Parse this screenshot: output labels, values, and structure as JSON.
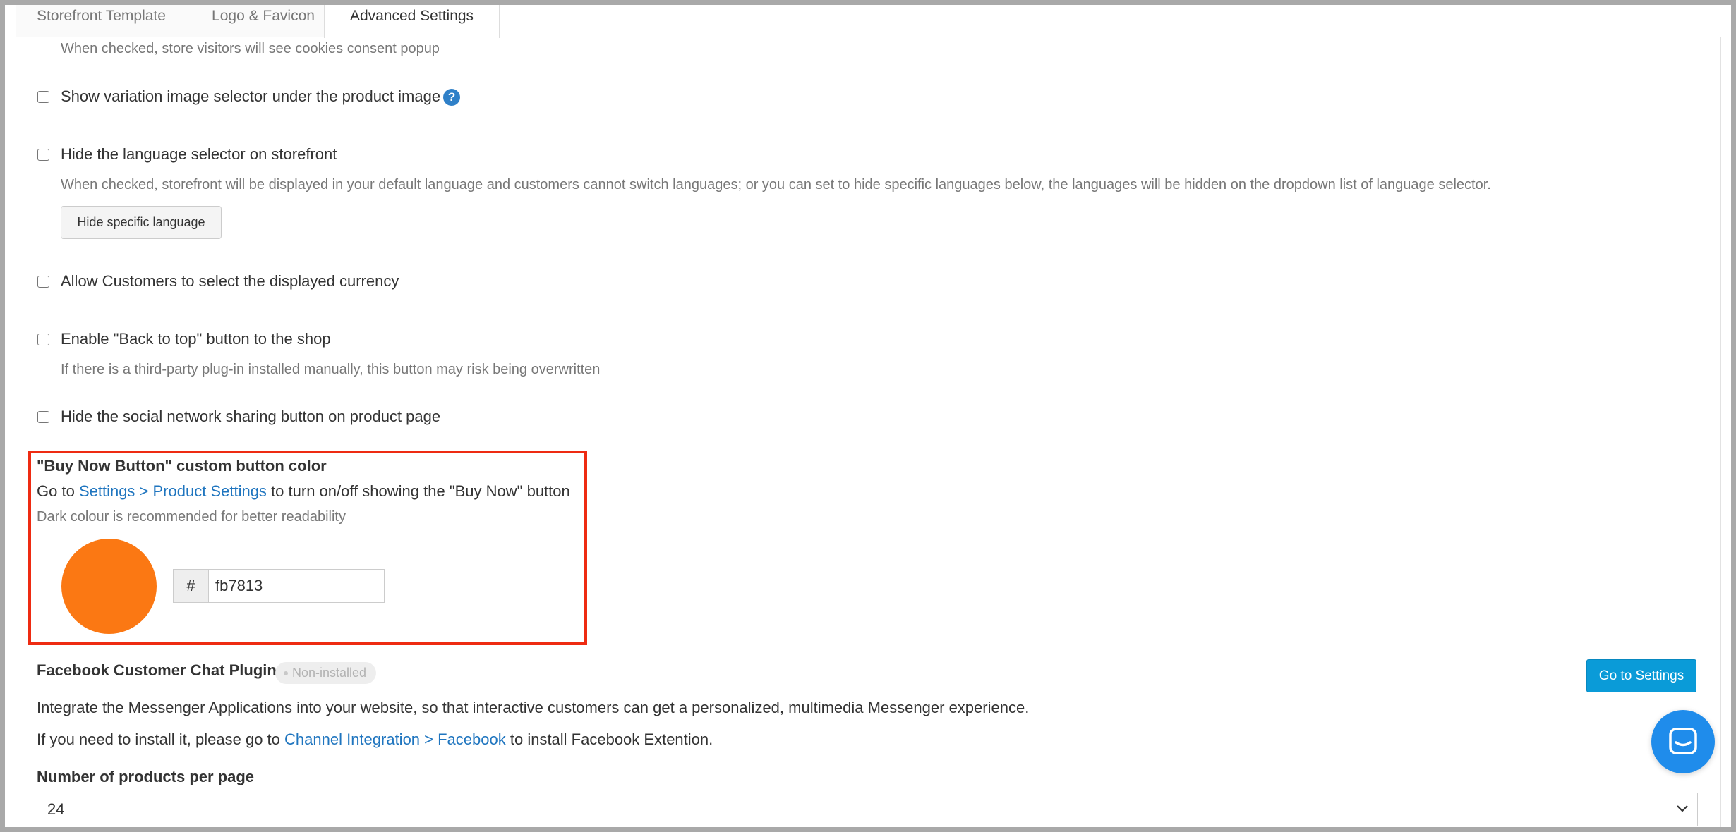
{
  "tabs": [
    {
      "label": "Storefront Template",
      "active": false
    },
    {
      "label": "Logo & Favicon",
      "active": false
    },
    {
      "label": "Advanced Settings",
      "active": true
    }
  ],
  "settings": {
    "cookies_help": "When checked, store visitors will see cookies consent popup",
    "variation_selector": {
      "label": "Show variation image selector under the product image",
      "checked": false,
      "icon": "question-circle-icon"
    },
    "hide_language": {
      "label": "Hide the language selector on storefront",
      "checked": false,
      "help": "When checked, storefront will be displayed in your default language and customers cannot switch languages; or you can set to hide specific languages below, the languages will be hidden on the dropdown list of language selector.",
      "button": "Hide specific language"
    },
    "currency": {
      "label": "Allow Customers to select the displayed currency",
      "checked": false
    },
    "back_to_top": {
      "label": "Enable \"Back to top\" button to the shop",
      "checked": false,
      "help": "If there is a third-party plug-in installed manually, this button may risk being overwritten"
    },
    "social_share": {
      "label": "Hide the social network sharing button on product page",
      "checked": false
    }
  },
  "buy_now": {
    "title": "\"Buy Now Button\" custom button color",
    "go_to": "Go to",
    "link": "Settings > Product Settings",
    "after_link": "to turn on/off showing the \"Buy Now\" button",
    "hint": "Dark colour is recommended for better readability",
    "hash": "#",
    "hex_value": "fb7813",
    "swatch_color": "#fb7813"
  },
  "facebook": {
    "title": "Facebook Customer Chat Plugin",
    "badge": "Non-installed",
    "button": "Go to Settings",
    "desc": "Integrate the Messenger Applications into your website, so that interactive customers can get a personalized, multimedia Messenger experience.",
    "install_prefix": "If you need to install it, please go to",
    "install_link": "Channel Integration > Facebook",
    "install_suffix": "to install Facebook Extention."
  },
  "products_per_page": {
    "label": "Number of products per page",
    "value": "24"
  },
  "colors": {
    "accent": "#1f75bf",
    "highlight_border": "#ee2b12",
    "primary_button": "#0a9bd8",
    "chat_launcher": "#1f8ceb"
  },
  "chat_launcher": {
    "icon": "chat-bubble-icon"
  }
}
